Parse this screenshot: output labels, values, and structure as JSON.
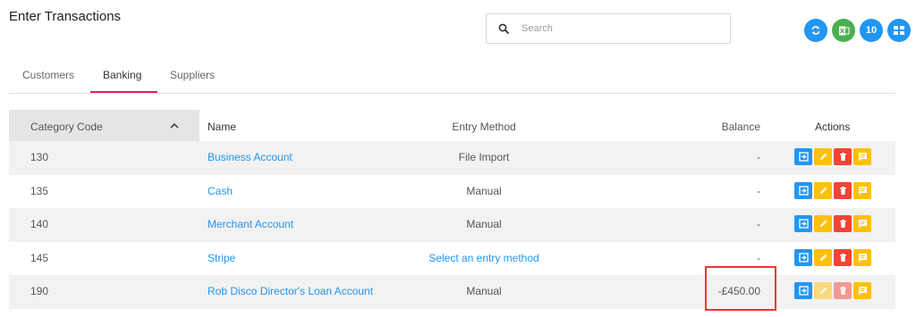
{
  "page": {
    "title": "Enter Transactions"
  },
  "search": {
    "placeholder": "Search"
  },
  "toolbar": {
    "page_size": "10"
  },
  "tabs": [
    {
      "label": "Customers",
      "active": false
    },
    {
      "label": "Banking",
      "active": true
    },
    {
      "label": "Suppliers",
      "active": false
    }
  ],
  "table": {
    "headers": {
      "code": "Category Code",
      "name": "Name",
      "method": "Entry Method",
      "balance": "Balance",
      "actions": "Actions"
    },
    "rows": [
      {
        "code": "130",
        "name": "Business Account",
        "method": "File Import",
        "balance": "-"
      },
      {
        "code": "135",
        "name": "Cash",
        "method": "Manual",
        "balance": "-"
      },
      {
        "code": "140",
        "name": "Merchant Account",
        "method": "Manual",
        "balance": "-"
      },
      {
        "code": "145",
        "name": "Stripe",
        "method": "Select an entry method",
        "balance": "-"
      },
      {
        "code": "190",
        "name": "Rob Disco Director's Loan Account",
        "method": "Manual",
        "balance": "-£450.00"
      }
    ]
  },
  "colors": {
    "accent": "#e91e63",
    "link": "#2196f3",
    "highlight": "#e53935"
  }
}
